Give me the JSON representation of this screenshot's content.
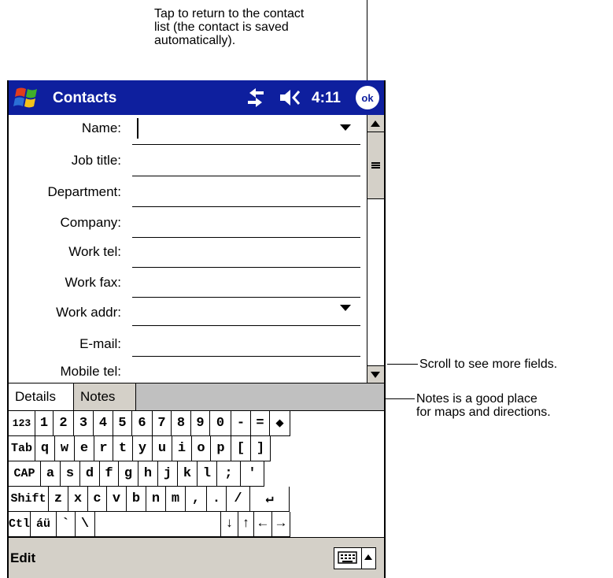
{
  "callouts": {
    "top": "Tap to return to the contact\nlist (the contact is saved\nautomatically).",
    "scroll": "Scroll to see more fields.",
    "notes": "Notes is a good place\nfor maps and directions."
  },
  "titlebar": {
    "title": "Contacts",
    "time": "4:11",
    "ok_label": "ok",
    "start_icon": "windows-flag-icon",
    "sync_icon": "sync-icon",
    "volume_icon": "volume-icon"
  },
  "form": {
    "fields": [
      {
        "label": "Name:",
        "has_dropdown": true
      },
      {
        "label": "Job title:"
      },
      {
        "label": "Department:"
      },
      {
        "label": "Company:"
      },
      {
        "label": "Work tel:"
      },
      {
        "label": "Work fax:"
      },
      {
        "label": "Work addr:",
        "has_dropdown": true
      },
      {
        "label": "E-mail:"
      },
      {
        "label": "Mobile tel:"
      }
    ]
  },
  "tabs": {
    "details": "Details",
    "notes": "Notes"
  },
  "keyboard": {
    "rows": [
      [
        "123",
        "1",
        "2",
        "3",
        "4",
        "5",
        "6",
        "7",
        "8",
        "9",
        "0",
        "-",
        "=",
        "◆"
      ],
      [
        "Tab",
        "q",
        "w",
        "e",
        "r",
        "t",
        "y",
        "u",
        "i",
        "o",
        "p",
        "[",
        "]"
      ],
      [
        "CAP",
        "a",
        "s",
        "d",
        "f",
        "g",
        "h",
        "j",
        "k",
        "l",
        ";",
        "'"
      ],
      [
        "Shift",
        "z",
        "x",
        "c",
        "v",
        "b",
        "n",
        "m",
        ",",
        ".",
        "/",
        "↵"
      ],
      [
        "Ctl",
        "áü",
        "`",
        "\\",
        " ",
        "↓",
        "↑",
        "←",
        "→"
      ]
    ]
  },
  "menubar": {
    "edit": "Edit",
    "keyboard_icon": "keyboard-icon",
    "arrow_icon": "up-arrow-icon"
  },
  "colors": {
    "titlebar": "#0e1f9e",
    "chrome": "#d4d0c8"
  }
}
